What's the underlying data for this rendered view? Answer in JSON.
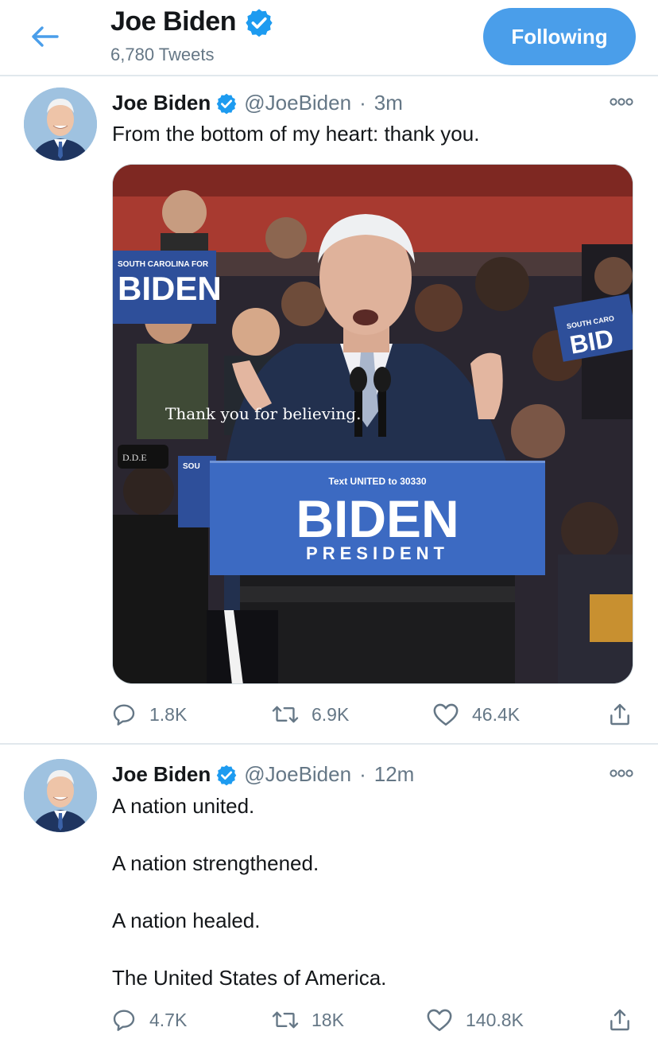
{
  "header": {
    "title": "Joe Biden",
    "tweet_count": "6,780 Tweets",
    "follow_label": "Following"
  },
  "colors": {
    "accent": "#4a9eea",
    "secondary_text": "#657786",
    "verified": "#1d9bf0"
  },
  "tweets": [
    {
      "name": "Joe Biden",
      "handle": "@JoeBiden",
      "separator": "·",
      "time": "3m",
      "text": "From the bottom of my heart: thank you.",
      "media": {
        "caption": "Thank you for believing.",
        "podium_top": "Text UNITED to 30330",
        "podium_brand": "BIDEN",
        "podium_sub": "PRESIDENT",
        "sign_left_top": "SOUTH CAROLINA FOR",
        "sign_left_main": "BIDEN",
        "sign_right_top": "SOUTH CARO",
        "sign_right_main": "BID",
        "hat_text": "D.D.E",
        "sign_small": "SOU"
      },
      "replies": "1.8K",
      "retweets": "6.9K",
      "likes": "46.4K"
    },
    {
      "name": "Joe Biden",
      "handle": "@JoeBiden",
      "separator": "·",
      "time": "12m",
      "lines": [
        "A nation united.",
        "A nation strengthened.",
        "A nation healed.",
        "The United States of America."
      ],
      "replies": "4.7K",
      "retweets": "18K",
      "likes": "140.8K"
    }
  ]
}
